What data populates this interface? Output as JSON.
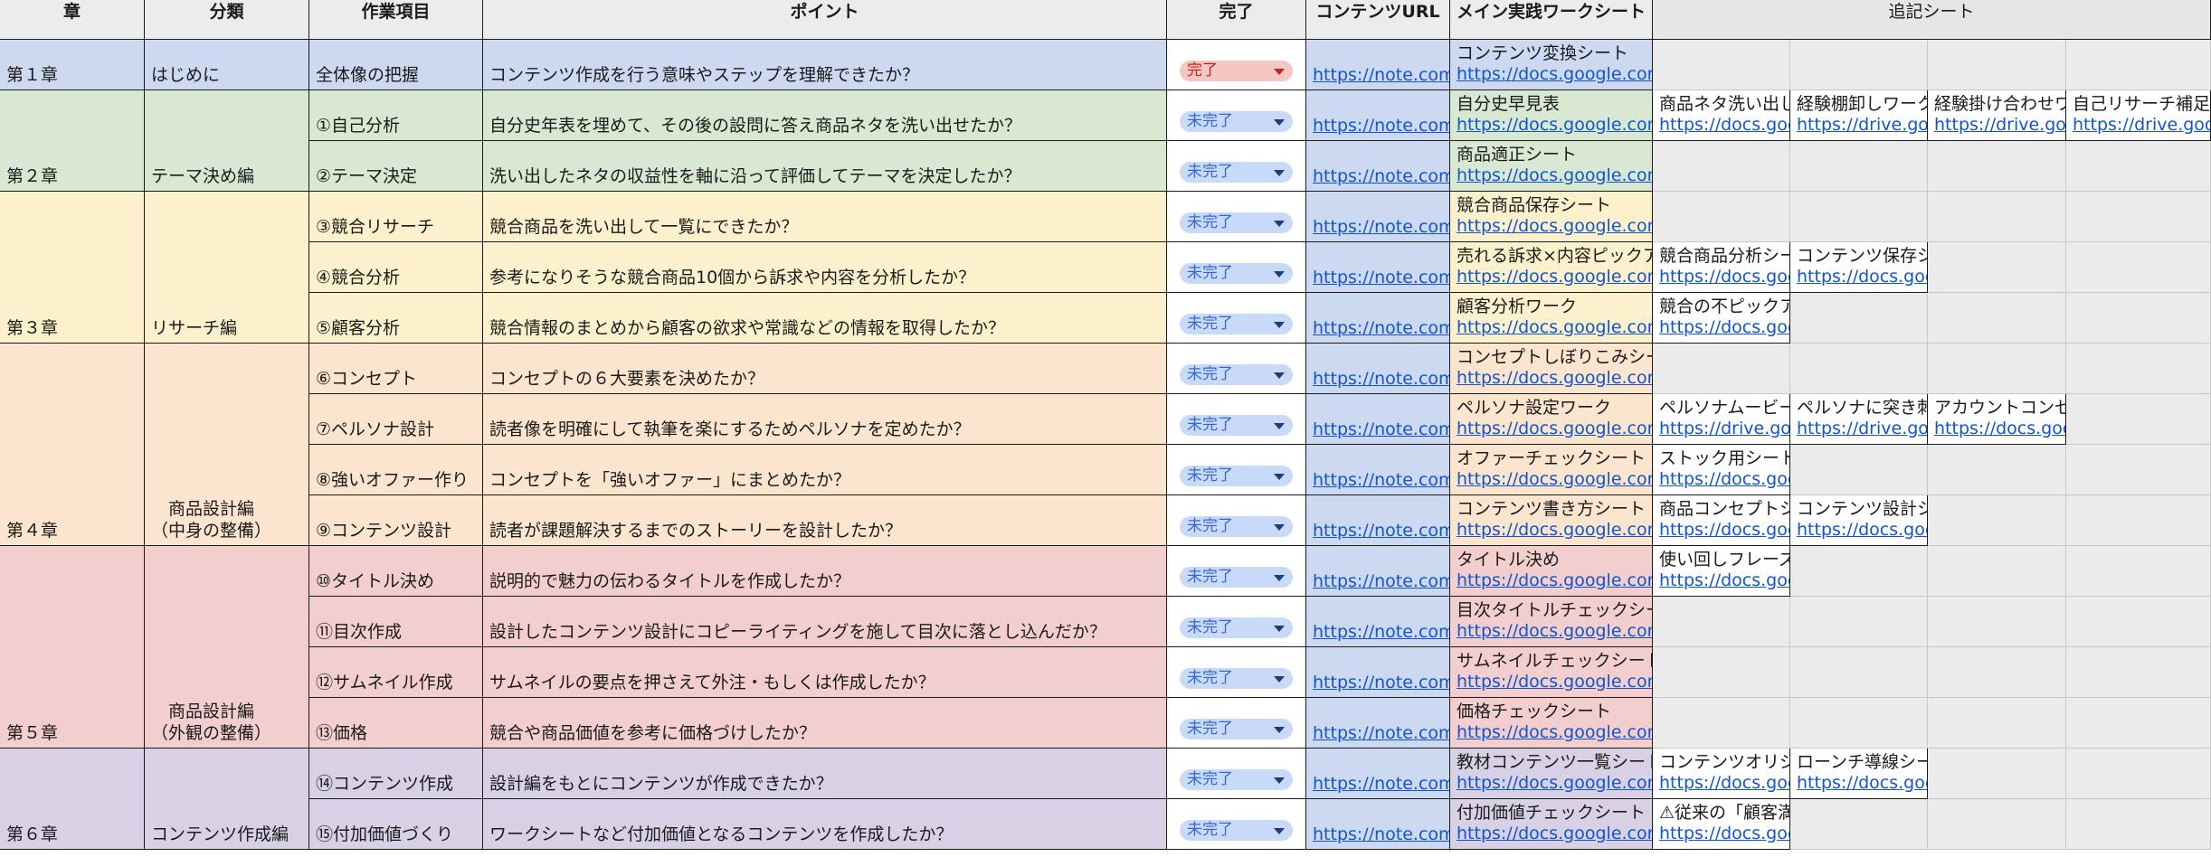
{
  "colors": {
    "ch1": "#cdd9f1",
    "ch2": "#d9e8d3",
    "ch3": "#fdf1cd",
    "ch4": "#fbe5cf",
    "ch5": "#f2cfce",
    "ch6": "#d8d1e6",
    "empty_cell": "#ebebeb",
    "header": "#ececec",
    "link": "#1155cc"
  },
  "headers": {
    "chapter": "章",
    "category": "分類",
    "task": "作業項目",
    "point": "ポイント",
    "done": "完了",
    "content_url": "コンテンツURL",
    "main_sheet": "メイン実践ワークシート",
    "extra_sheet": "追記シート"
  },
  "chapters": [
    {
      "label": "第１章",
      "category": "はじめに"
    },
    {
      "label": "第２章",
      "category": "テーマ決め編"
    },
    {
      "label": "第３章",
      "category": "リサーチ編"
    },
    {
      "label": "第４章",
      "category": "商品設計編\n（中身の整備）"
    },
    {
      "label": "第５章",
      "category": "商品設計編\n（外観の整備）"
    },
    {
      "label": "第６章",
      "category": "コンテンツ作成編"
    }
  ],
  "rows": [
    {
      "task": "全体像の把握",
      "point": "コンテンツ作成を行う意味やステップを理解できたか？",
      "status": "完了",
      "url": "https://note.com/",
      "main_title": "コンテンツ変換シート",
      "main_url": "https://docs.google.com/spreadsheets/",
      "extras": []
    },
    {
      "task": "①自己分析",
      "point": "自分史年表を埋めて、その後の設問に答え商品ネタを洗い出せたか？",
      "status": "未完了",
      "url": "https://note.com/",
      "main_title": "自分史早見表",
      "main_url": "https://docs.google.com/spreadsheets/",
      "extras": [
        {
          "title": "商品ネタ洗い出しシート",
          "url": "https://docs.google.com/"
        },
        {
          "title": "経験棚卸しワークシート",
          "url": "https://drive.google.com/"
        },
        {
          "title": "経験掛け合わせワーク",
          "url": "https://drive.google.com/"
        },
        {
          "title": "自己リサーチ補足シート",
          "url": "https://drive.google.com/"
        }
      ]
    },
    {
      "task": "②テーマ決定",
      "point": "洗い出したネタの収益性を軸に沿って評価してテーマを決定したか？",
      "status": "未完了",
      "url": "https://note.com/",
      "main_title": "商品適正シート",
      "main_url": "https://docs.google.com/spreadsheets/",
      "extras": []
    },
    {
      "task": "③競合リサーチ",
      "point": "競合商品を洗い出して一覧にできたか？",
      "status": "未完了",
      "url": "https://note.com/",
      "main_title": "競合商品保存シート",
      "main_url": "https://docs.google.com/spreadsheets/",
      "extras": []
    },
    {
      "task": "④競合分析",
      "point": "参考になりそうな競合商品10個から訴求や内容を分析したか？",
      "status": "未完了",
      "url": "https://note.com/",
      "main_title": "売れる訴求×内容ピックアップシート",
      "main_url": "https://docs.google.com/spreadsheets/",
      "extras": [
        {
          "title": "競合商品分析シート",
          "url": "https://docs.google.com/"
        },
        {
          "title": "コンテンツ保存シート",
          "url": "https://docs.google.com/"
        }
      ]
    },
    {
      "task": "⑤顧客分析",
      "point": "競合情報のまとめから顧客の欲求や常識などの情報を取得したか？",
      "status": "未完了",
      "url": "https://note.com/",
      "main_title": "顧客分析ワーク",
      "main_url": "https://docs.google.com/spreadsheets/",
      "extras": [
        {
          "title": "競合の不ピックアップ",
          "url": "https://docs.google.com/"
        }
      ]
    },
    {
      "task": "⑥コンセプト",
      "point": "コンセプトの６大要素を決めたか？",
      "status": "未完了",
      "url": "https://note.com/",
      "main_title": "コンセプトしぼりこみシート",
      "main_url": "https://docs.google.com/spreadsheets/",
      "extras": []
    },
    {
      "task": "⑦ペルソナ設計",
      "point": "読者像を明確にして執筆を楽にするためペルソナを定めたか？",
      "status": "未完了",
      "url": "https://note.com/",
      "main_title": "ペルソナ設定ワーク",
      "main_url": "https://docs.google.com/spreadsheets/",
      "extras": [
        {
          "title": "ペルソナムービーシート",
          "url": "https://drive.google.com/"
        },
        {
          "title": "ペルソナに突き刺す",
          "url": "https://drive.google.com/"
        },
        {
          "title": "アカウントコンセプト",
          "url": "https://docs.google.com/"
        }
      ]
    },
    {
      "task": "⑧強いオファー作り",
      "point": "コンセプトを「強いオファー」にまとめたか？",
      "status": "未完了",
      "url": "https://note.com/",
      "main_title": "オファーチェックシート",
      "main_url": "https://docs.google.com/spreadsheets/",
      "extras": [
        {
          "title": "ストック用シート",
          "url": "https://docs.google.com/"
        }
      ]
    },
    {
      "task": "⑨コンテンツ設計",
      "point": "読者が課題解決するまでのストーリーを設計したか？",
      "status": "未完了",
      "url": "https://note.com/",
      "main_title": "コンテンツ書き方シート",
      "main_url": "https://docs.google.com/spreadsheets/",
      "extras": [
        {
          "title": "商品コンセプトシート",
          "url": "https://docs.google.com/"
        },
        {
          "title": "コンテンツ設計シート",
          "url": "https://docs.google.com/"
        }
      ]
    },
    {
      "task": "⑩タイトル決め",
      "point": "説明的で魅力の伝わるタイトルを作成したか？",
      "status": "未完了",
      "url": "https://note.com/",
      "main_title": "タイトル決め",
      "main_url": "https://docs.google.com/spreadsheets/",
      "extras": [
        {
          "title": "使い回しフレーズ",
          "url": "https://docs.google.com/"
        }
      ]
    },
    {
      "task": "⑪目次作成",
      "point": "設計したコンテンツ設計にコピーライティングを施して目次に落とし込んだか？",
      "status": "未完了",
      "url": "https://note.com/",
      "main_title": "目次タイトルチェックシート",
      "main_url": "https://docs.google.com/spreadsheets/",
      "extras": []
    },
    {
      "task": "⑫サムネイル作成",
      "point": "サムネイルの要点を押さえて外注・もしくは作成したか？",
      "status": "未完了",
      "url": "https://note.com/",
      "main_title": "サムネイルチェックシート",
      "main_url": "https://docs.google.com/spreadsheets/",
      "extras": []
    },
    {
      "task": "⑬価格",
      "point": "競合や商品価値を参考に価格づけしたか？",
      "status": "未完了",
      "url": "https://note.com/",
      "main_title": "価格チェックシート",
      "main_url": "https://docs.google.com/spreadsheets/",
      "extras": []
    },
    {
      "task": "⑭コンテンツ作成",
      "point": "設計編をもとにコンテンツが作成できたか？",
      "status": "未完了",
      "url": "https://note.com/",
      "main_title": "教材コンテンツ一覧シート",
      "main_url": "https://docs.google.com/spreadsheets/",
      "extras": [
        {
          "title": "コンテンツオリジナル",
          "url": "https://docs.google.com/"
        },
        {
          "title": "ローンチ導線シート",
          "url": "https://docs.google.com/"
        }
      ]
    },
    {
      "task": "⑮付加価値づくり",
      "point": "ワークシートなど付加価値となるコンテンツを作成したか？",
      "status": "未完了",
      "url": "https://note.com/",
      "main_title": "付加価値チェックシート",
      "main_url": "https://docs.google.com/spreadsheets/",
      "extras": [
        {
          "title": "⚠従来の「顧客満足」",
          "url": "https://docs.google.com/"
        }
      ]
    }
  ]
}
